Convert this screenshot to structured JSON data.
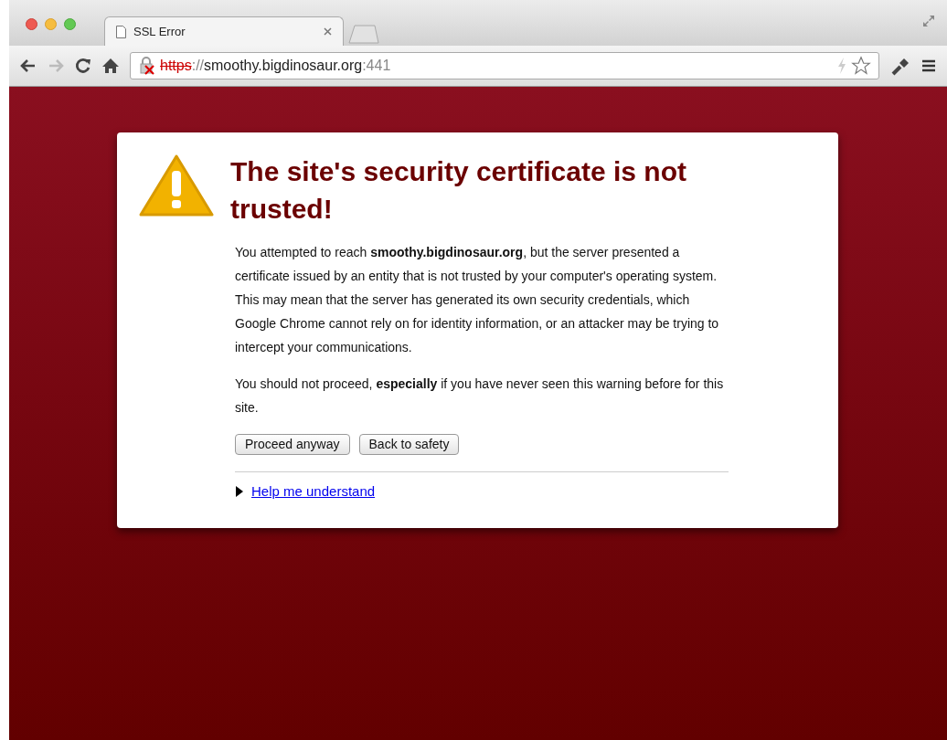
{
  "tab": {
    "title": "SSL Error",
    "selected": true
  },
  "toolbar": {
    "url": {
      "scheme": "https",
      "separator": "://",
      "host": "smoothy.bigdinosaur.org",
      "port": ":441"
    }
  },
  "error": {
    "title": "The site's security certificate is not trusted!",
    "paragraphs": [
      "You attempted to reach **smoothy.bigdinosaur.org**, but the server presented a certificate issued by an entity that is not trusted by your computer's operating system. This may mean that the server has generated its own security credentials, which Google Chrome cannot rely on for identity information, or an attacker may be trying to intercept your communications.",
      "You should not proceed, **especially** if you have never seen this warning before for this site."
    ],
    "buttons": [
      "Proceed anyway",
      "Back to safety"
    ],
    "help": {
      "label": "Help me understand",
      "expanded": false
    }
  }
}
